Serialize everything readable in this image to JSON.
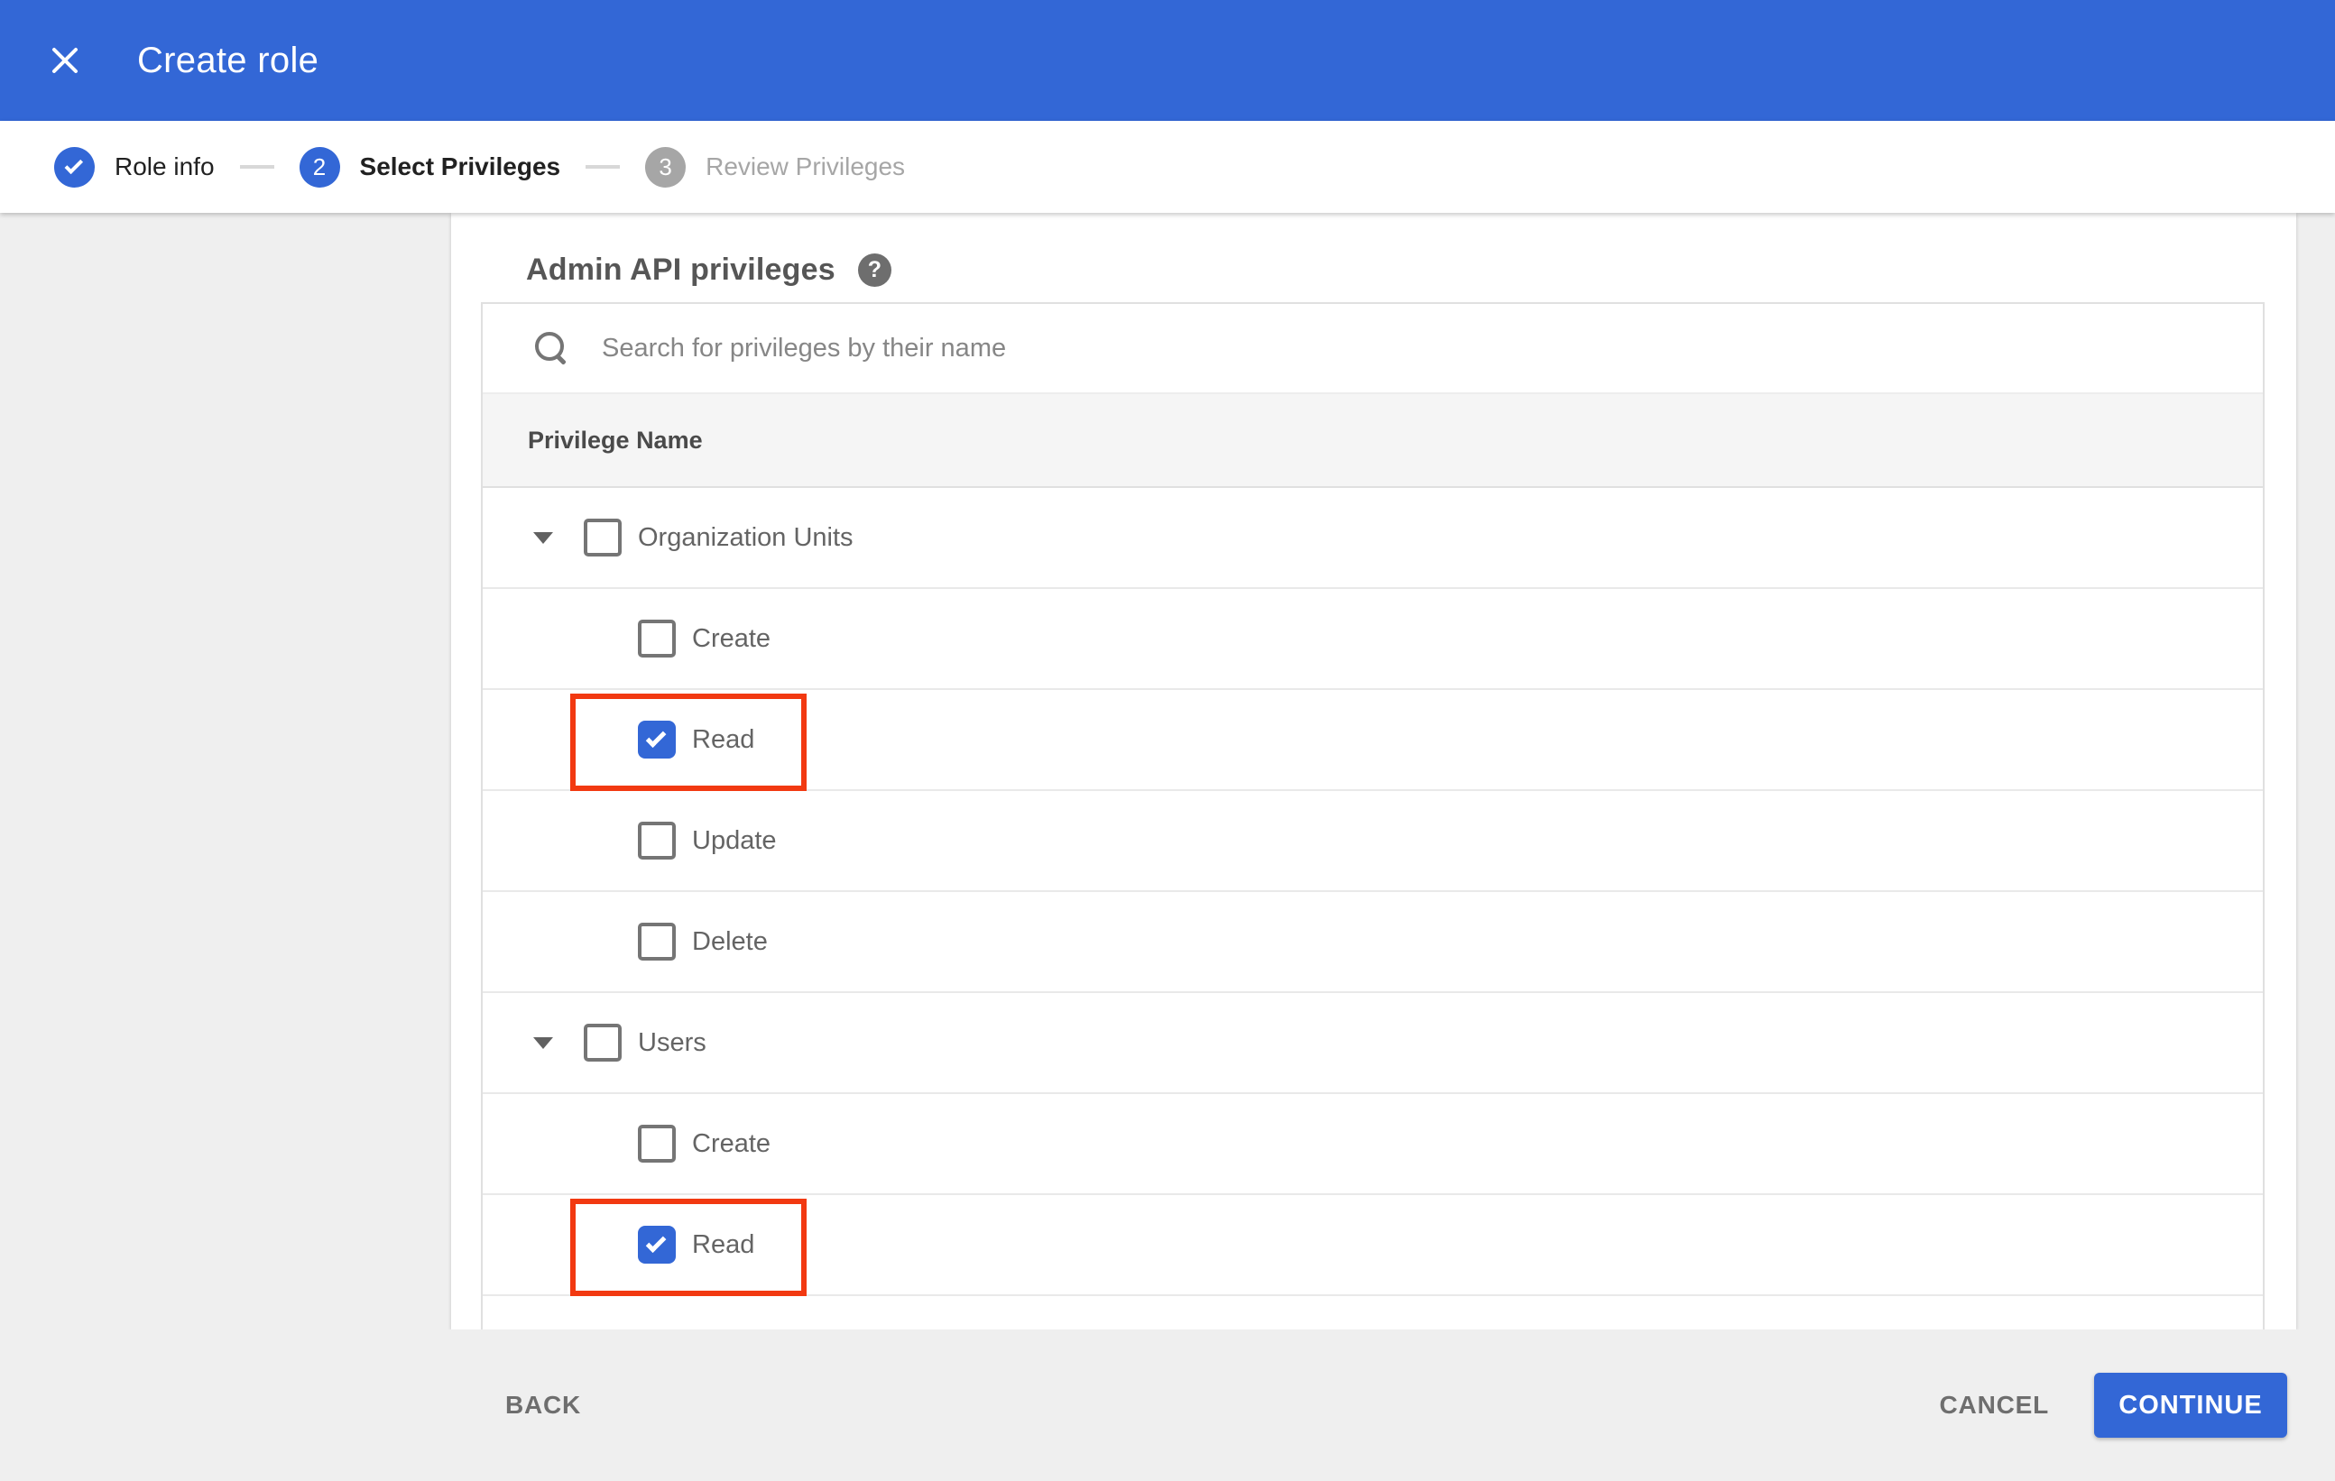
{
  "header": {
    "title": "Create role"
  },
  "stepper": {
    "steps": [
      {
        "label": "Role info",
        "state": "completed",
        "icon": "check"
      },
      {
        "label": "Select Privileges",
        "state": "active",
        "number": "2"
      },
      {
        "label": "Review Privileges",
        "state": "upcoming",
        "number": "3"
      }
    ]
  },
  "content": {
    "heading": "Admin API privileges",
    "help_icon_glyph": "?",
    "search": {
      "placeholder": "Search for privileges by their name",
      "value": ""
    },
    "table": {
      "header": "Privilege Name",
      "rows": [
        {
          "label": "Organization Units",
          "level": "parent",
          "expanded": true,
          "checked": false,
          "highlighted": false
        },
        {
          "label": "Create",
          "level": "child",
          "checked": false,
          "highlighted": false
        },
        {
          "label": "Read",
          "level": "child",
          "checked": true,
          "highlighted": true
        },
        {
          "label": "Update",
          "level": "child",
          "checked": false,
          "highlighted": false
        },
        {
          "label": "Delete",
          "level": "child",
          "checked": false,
          "highlighted": false
        },
        {
          "label": "Users",
          "level": "parent",
          "expanded": true,
          "checked": false,
          "highlighted": false
        },
        {
          "label": "Create",
          "level": "child",
          "checked": false,
          "highlighted": false
        },
        {
          "label": "Read",
          "level": "child",
          "checked": true,
          "highlighted": true
        }
      ]
    }
  },
  "footer": {
    "back_label": "BACK",
    "cancel_label": "CANCEL",
    "continue_label": "CONTINUE"
  },
  "colors": {
    "accent_blue": "#3367d6",
    "highlight_red": "#f23911",
    "page_background": "#efefef",
    "table_header_background": "#f5f5f5",
    "inactive_gray": "#a6a6a6"
  }
}
